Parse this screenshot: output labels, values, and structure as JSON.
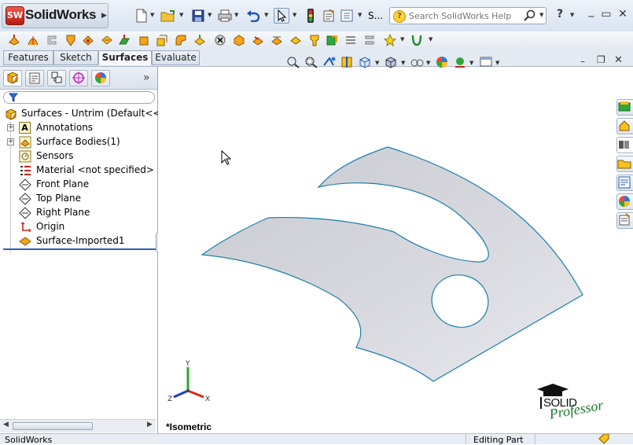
{
  "app": {
    "title": "SolidWorks",
    "logo_badge": "SW"
  },
  "toolbar_top": {
    "truncated_label": "S...",
    "search_placeholder": "Search SolidWorks Help",
    "help_label": "?",
    "help_icon_label": "?"
  },
  "tabs": [
    {
      "label": "Features",
      "active": false
    },
    {
      "label": "Sketch",
      "active": false
    },
    {
      "label": "Surfaces",
      "active": true
    },
    {
      "label": "Evaluate",
      "active": false
    }
  ],
  "feature_tree": {
    "root": "Surfaces - Untrim  (Default<<De",
    "items": [
      {
        "label": "Annotations",
        "icon": "annotations-icon",
        "expandable": true
      },
      {
        "label": "Surface Bodies(1)",
        "icon": "surface-bodies-icon",
        "expandable": true
      },
      {
        "label": "Sensors",
        "icon": "sensors-icon",
        "expandable": false
      },
      {
        "label": "Material <not specified>",
        "icon": "material-icon",
        "expandable": false
      },
      {
        "label": "Front Plane",
        "icon": "plane-icon",
        "expandable": false
      },
      {
        "label": "Top Plane",
        "icon": "plane-icon",
        "expandable": false
      },
      {
        "label": "Right Plane",
        "icon": "plane-icon",
        "expandable": false
      },
      {
        "label": "Origin",
        "icon": "origin-icon",
        "expandable": false
      },
      {
        "label": "Surface-Imported1",
        "icon": "surface-imported-icon",
        "expandable": false
      }
    ],
    "annotation_letter": "A"
  },
  "viewport": {
    "view_name": "*Isometric",
    "triad": {
      "x": "X",
      "y": "Y",
      "z": "Z"
    },
    "watermark_line1": "SOLID",
    "watermark_line2": "Professor"
  },
  "status": {
    "left": "SolidWorks",
    "right": "Editing Part"
  },
  "colors": {
    "surface_fill": "#d3d4da",
    "surface_edge": "#1b7fa8",
    "tab_active_bg": "#f7f9fc",
    "accent_red": "#c8231a"
  }
}
